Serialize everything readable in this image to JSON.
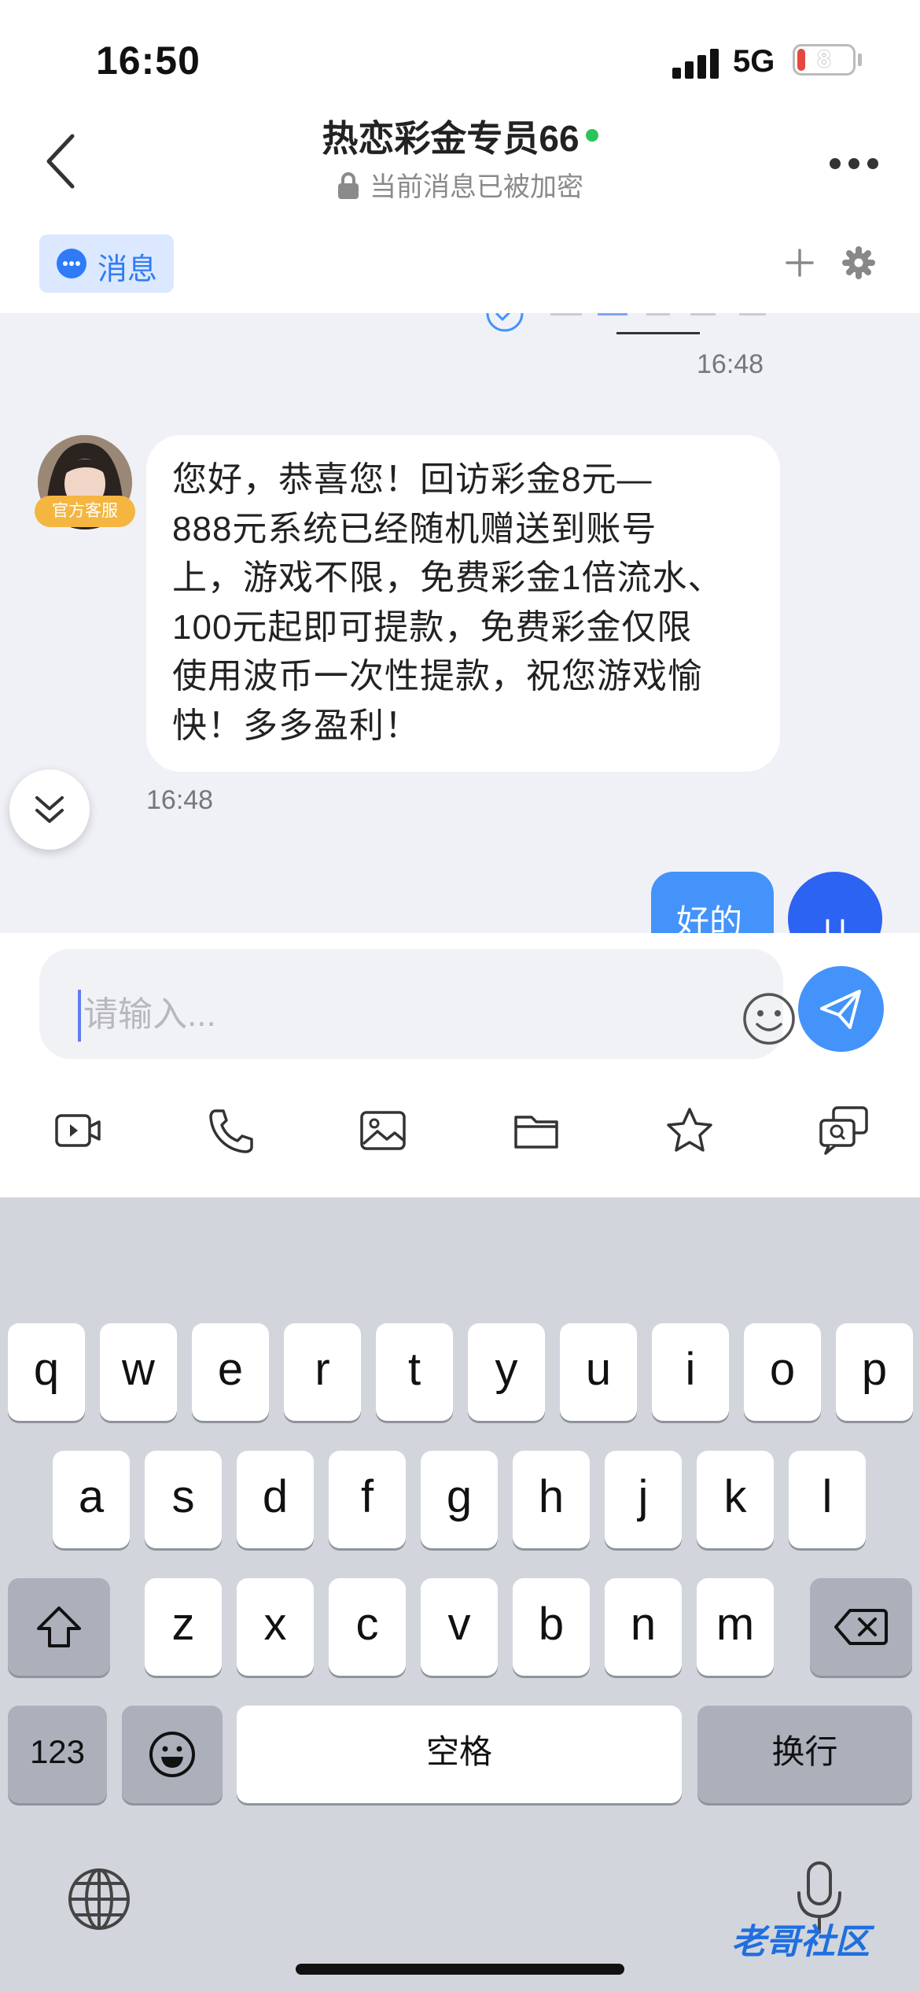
{
  "status_bar": {
    "time": "16:50",
    "network": "5G",
    "battery": "8"
  },
  "header": {
    "title": "热恋彩金专员66",
    "encryption_note": "当前消息已被加密",
    "tab_messages": "消息"
  },
  "chat": {
    "timestamp_top": "16:48",
    "incoming": {
      "badge": "官方客服",
      "lines": [
        "您好，恭喜您！回访彩金8元—",
        "888元系统已经随机赠送到账号",
        "上，游戏不限，免费彩金1倍流水、",
        "100元起即可提款，免费彩金仅限",
        "使用波币一次性提款，祝您游戏愉",
        "快！多多盈利！"
      ],
      "time": "16:48"
    },
    "outgoing": {
      "text": "好的",
      "avatar_letter": "U"
    }
  },
  "input": {
    "placeholder": "请输入..."
  },
  "keyboard": {
    "row1": [
      "q",
      "w",
      "e",
      "r",
      "t",
      "y",
      "u",
      "i",
      "o",
      "p"
    ],
    "row2": [
      "a",
      "s",
      "d",
      "f",
      "g",
      "h",
      "j",
      "k",
      "l"
    ],
    "row3": [
      "z",
      "x",
      "c",
      "v",
      "b",
      "n",
      "m"
    ],
    "numbers_label": "123",
    "space_label": "空格",
    "return_label": "换行"
  },
  "watermark": "老哥社区",
  "colors": {
    "accent": "#4393fb",
    "badge": "#f4b640",
    "online": "#2bc35b"
  }
}
